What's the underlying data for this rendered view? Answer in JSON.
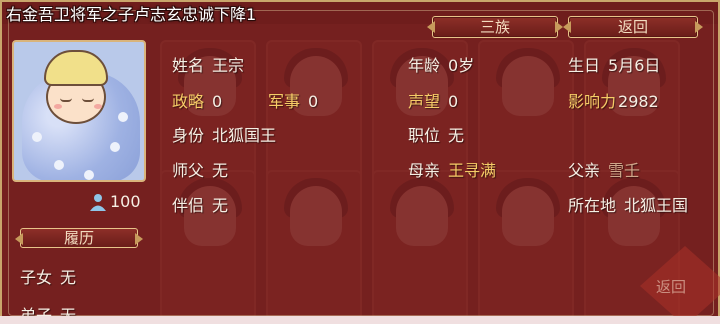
{
  "title": "右金吾卫将军之子卢志玄忠诚下降1",
  "tabs": {
    "clan_label": "三族",
    "back_label": "返回"
  },
  "avatar": {
    "icon": "swaddled-baby-portrait",
    "popularity_icon": "person-icon",
    "popularity": "100"
  },
  "fields": {
    "name_k": "姓名",
    "name_v": "王宗",
    "strategy_k": "政略",
    "strategy_v": "0",
    "military_k": "军事",
    "military_v": "0",
    "identity_k": "身份",
    "identity_v": "北狐国王",
    "master_k": "师父",
    "master_v": "无",
    "spouse_k": "伴侣",
    "spouse_v": "无",
    "age_k": "年龄",
    "age_v": "0岁",
    "fame_k": "声望",
    "fame_v": "0",
    "post_k": "职位",
    "post_v": "无",
    "mother_k": "母亲",
    "mother_v": "王寻满",
    "birthday_k": "生日",
    "birthday_v": "5月6日",
    "influence_k": "影响力",
    "influence_v": "2982",
    "father_k": "父亲",
    "father_v": "雪壬",
    "location_k": "所在地",
    "location_v": "北狐王国"
  },
  "history": {
    "section_label": "履历",
    "children_k": "子女",
    "children_v": "无",
    "disciples_k": "弟子",
    "disciples_v": "无"
  },
  "corner_back_label": "返回",
  "colors": {
    "panel": "#781e1e",
    "gold_label": "#f6cc67",
    "border": "#c9a66b"
  }
}
